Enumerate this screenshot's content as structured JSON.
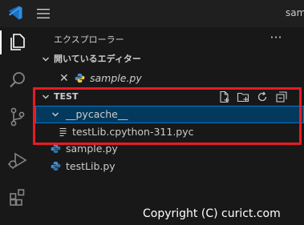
{
  "titlebar": {
    "title": "sampl"
  },
  "explorer": {
    "title": "エクスプローラー",
    "more": "···",
    "open_editors": {
      "label": "開いているエディター",
      "files": [
        {
          "name": "sample.py"
        }
      ]
    },
    "workspace": {
      "label": "TEST",
      "folder": {
        "name": "__pycache__",
        "children": [
          {
            "name": "testLib.cpython-311.pyc"
          }
        ]
      },
      "files": [
        {
          "name": "sample.py"
        },
        {
          "name": "testLib.py"
        }
      ]
    }
  },
  "watermark": "Copyright (C) curict.com",
  "colors": {
    "highlight": "#e81a24",
    "selection": "#04395e",
    "focus_border": "#0078d4",
    "python_blue": "#3d8fd4"
  }
}
